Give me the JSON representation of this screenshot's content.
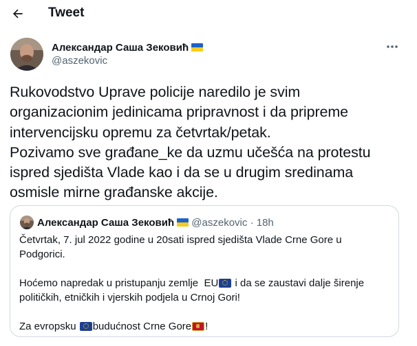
{
  "header": {
    "title": "Tweet",
    "back_icon": "arrow-left-icon"
  },
  "tweet": {
    "author_name": "Александар Саша Зековић",
    "author_handle": "@aszekovic",
    "author_flag": "ukraine-flag-icon",
    "more_icon": "more-horizontal-icon",
    "lines": [
      "Rukovodstvo Uprave policije naredilo je svim",
      "organizacionim jedinicama pripravnost i da pripreme",
      "intervencijsku opremu za četvrtak/petak.",
      "Pozivamo sve građane_ke da uzmu učešća na protestu",
      "ispred sjedišta Vlade kao i da se u drugim sredinama",
      "osmisle mirne građanske akcije."
    ]
  },
  "quote": {
    "author_name": "Александар Саша Зековић",
    "author_handle": "@aszekovic",
    "separator": "·",
    "time": "18h",
    "line1": "Četvrtak, 7. jul 2022 godine u 20sati ispred sjedišta Vlade Crne Gore u",
    "line2": "Podgorici.",
    "line3_a": "Hoćemo napredak u pristupanju zemlje  EU",
    "line3_b": " i da se zaustavi dalje širenje",
    "line4": "političkih, etničkih i vjerskih podjela u Crnoj Gori!",
    "line5_a": "Za evropsku ",
    "line5_b": "budućnost Crne Gore",
    "line5_c": "!"
  },
  "colors": {
    "text": "#0f1419",
    "secondary": "#536471",
    "border": "#cfd9de"
  }
}
